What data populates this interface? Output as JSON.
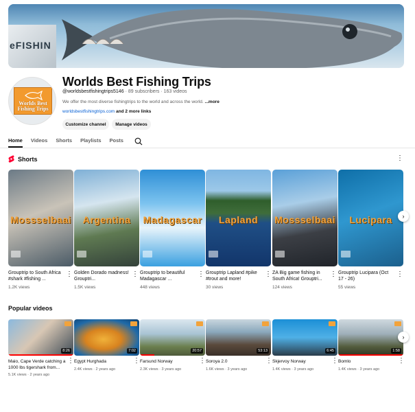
{
  "channel": {
    "name": "Worlds Best Fishing Trips",
    "handle": "@worldsbestfishingtrips5146",
    "subscribers": "89 subscribers",
    "videos": "163 videos",
    "separator": "·",
    "description": "We offer the most diverse fishingtrips to the world and across the world.",
    "more_label": "...more",
    "link": "worldsbestfishingtrips.com",
    "links_extra": "and 2 more links",
    "banner_text": "eFISHIN",
    "avatar_logo_text": "Worlds Best Fishing Trips"
  },
  "buttons": {
    "customize": "Customize channel",
    "manage": "Manage videos"
  },
  "tabs": [
    "Home",
    "Videos",
    "Shorts",
    "Playlists",
    "Posts"
  ],
  "icons": {
    "search": "search-icon",
    "shorts": "shorts-icon",
    "more": "more-vert-icon",
    "next": "chevron-right-icon"
  },
  "shorts_section": {
    "title": "Shorts",
    "items": [
      {
        "overlay": "Mossselbaai",
        "title": "Grouptrip to South Africa #shark #fishing ...",
        "views": "1.2K views"
      },
      {
        "overlay": "Argentina",
        "title": "Golden Dorado madness! Grouptri...",
        "views": "1.5K views"
      },
      {
        "overlay": "Madagascar",
        "title": "Grouptrip to beautiful Madagascar ...",
        "views": "448 views"
      },
      {
        "overlay": "Lapland",
        "title": "Grouptrip Lapland #pike #trout and more!",
        "views": "30 views"
      },
      {
        "overlay": "Mossselbaai",
        "title": "ZA Big game fishing in South Africa! Grouptri...",
        "views": "124 views"
      },
      {
        "overlay": "Lucipara",
        "title": "Grouptrip Lucipara (Oct 17 - 26)",
        "views": "55 views"
      }
    ]
  },
  "popular_section": {
    "title": "Popular videos",
    "items": [
      {
        "title": "Maio, Cape Verde catching a 1000 lbs tigershark from...",
        "meta": "5.1K views · 2 years ago",
        "duration": "8:26"
      },
      {
        "title": "Egypt Hurghada",
        "meta": "2.4K views · 2 years ago",
        "duration": "7:02"
      },
      {
        "title": "Farsund Norway",
        "meta": "2.3K views · 3 years ago",
        "duration": "20:57"
      },
      {
        "title": "Soroya 2.0",
        "meta": "1.6K views · 3 years ago",
        "duration": "53:13"
      },
      {
        "title": "Skjervoy Norway",
        "meta": "1.4K views · 3 years ago",
        "duration": "6:45"
      },
      {
        "title": "Bomlo",
        "meta": "1.4K views · 3 years ago",
        "duration": "1:58"
      }
    ]
  },
  "colors": {
    "accent_red": "#ff0000",
    "link_blue": "#065fd4",
    "overlay_orange": "#f2a33c"
  }
}
